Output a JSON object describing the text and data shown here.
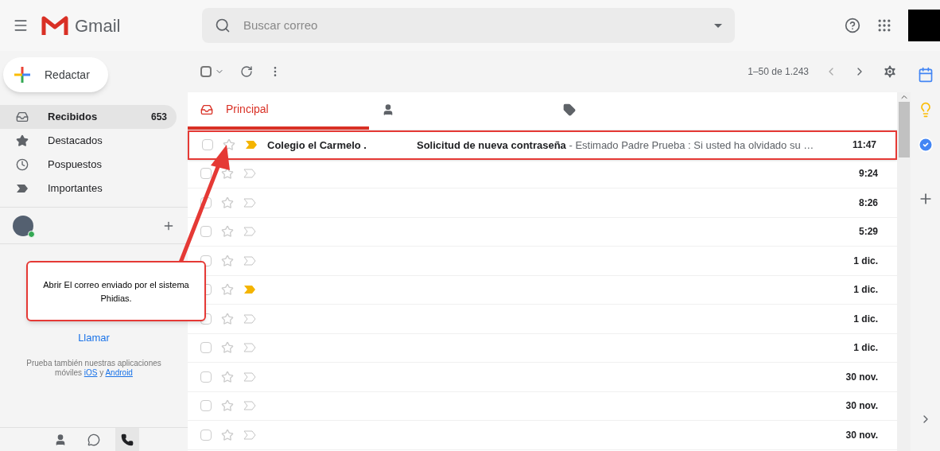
{
  "header": {
    "app_name": "Gmail",
    "search": {
      "placeholder": "Buscar correo"
    }
  },
  "compose": {
    "label": "Redactar"
  },
  "nav": [
    {
      "label": "Recibidos",
      "count": "653",
      "selected": true,
      "kind": "inbox"
    },
    {
      "label": "Destacados",
      "selected": false,
      "kind": "star"
    },
    {
      "label": "Pospuestos",
      "selected": false,
      "kind": "clock"
    },
    {
      "label": "Importantes",
      "selected": false,
      "kind": "important"
    }
  ],
  "hangouts": {
    "call_link": "Llamar",
    "promo_before": "Prueba también nuestras aplicaciones móviles",
    "ios_link": "iOS",
    "and": "y",
    "android_link": "Android",
    "tabs": [
      {
        "kind": "person",
        "selected": false
      },
      {
        "kind": "hangouts",
        "selected": false
      },
      {
        "kind": "phone",
        "selected": true
      }
    ]
  },
  "toolbar": {
    "select_all_checked": false,
    "pagination": "1–50 de 1.243"
  },
  "tabs": [
    {
      "kind": "inbox",
      "label": "Principal",
      "selected": true
    },
    {
      "kind": "social",
      "selected": false
    },
    {
      "kind": "promotions",
      "selected": false
    }
  ],
  "emails": [
    {
      "sender": "Colegio el Carmelo .",
      "subject": "Solicitud de nueva contraseña",
      "snippet": " - Estimado Padre Prueba : Si usted ha olvidado su …",
      "time": "11:47",
      "important": true,
      "highlighted": true
    },
    {
      "time": "9:24",
      "important": false,
      "highlighted": false
    },
    {
      "time": "8:26",
      "important": false,
      "highlighted": false
    },
    {
      "time": "5:29",
      "important": false,
      "highlighted": false
    },
    {
      "time": "1 dic.",
      "important": false,
      "highlighted": false
    },
    {
      "time": "1 dic.",
      "important": true,
      "highlighted": false
    },
    {
      "time": "1 dic.",
      "important": false,
      "highlighted": false
    },
    {
      "time": "1 dic.",
      "important": false,
      "highlighted": false
    },
    {
      "time": "30 nov.",
      "important": false,
      "highlighted": false
    },
    {
      "time": "30 nov.",
      "important": false,
      "highlighted": false
    },
    {
      "time": "30 nov.",
      "important": false,
      "highlighted": false
    }
  ],
  "annotation": {
    "text": "Abrir El correo enviado por el sistema Phidias."
  }
}
